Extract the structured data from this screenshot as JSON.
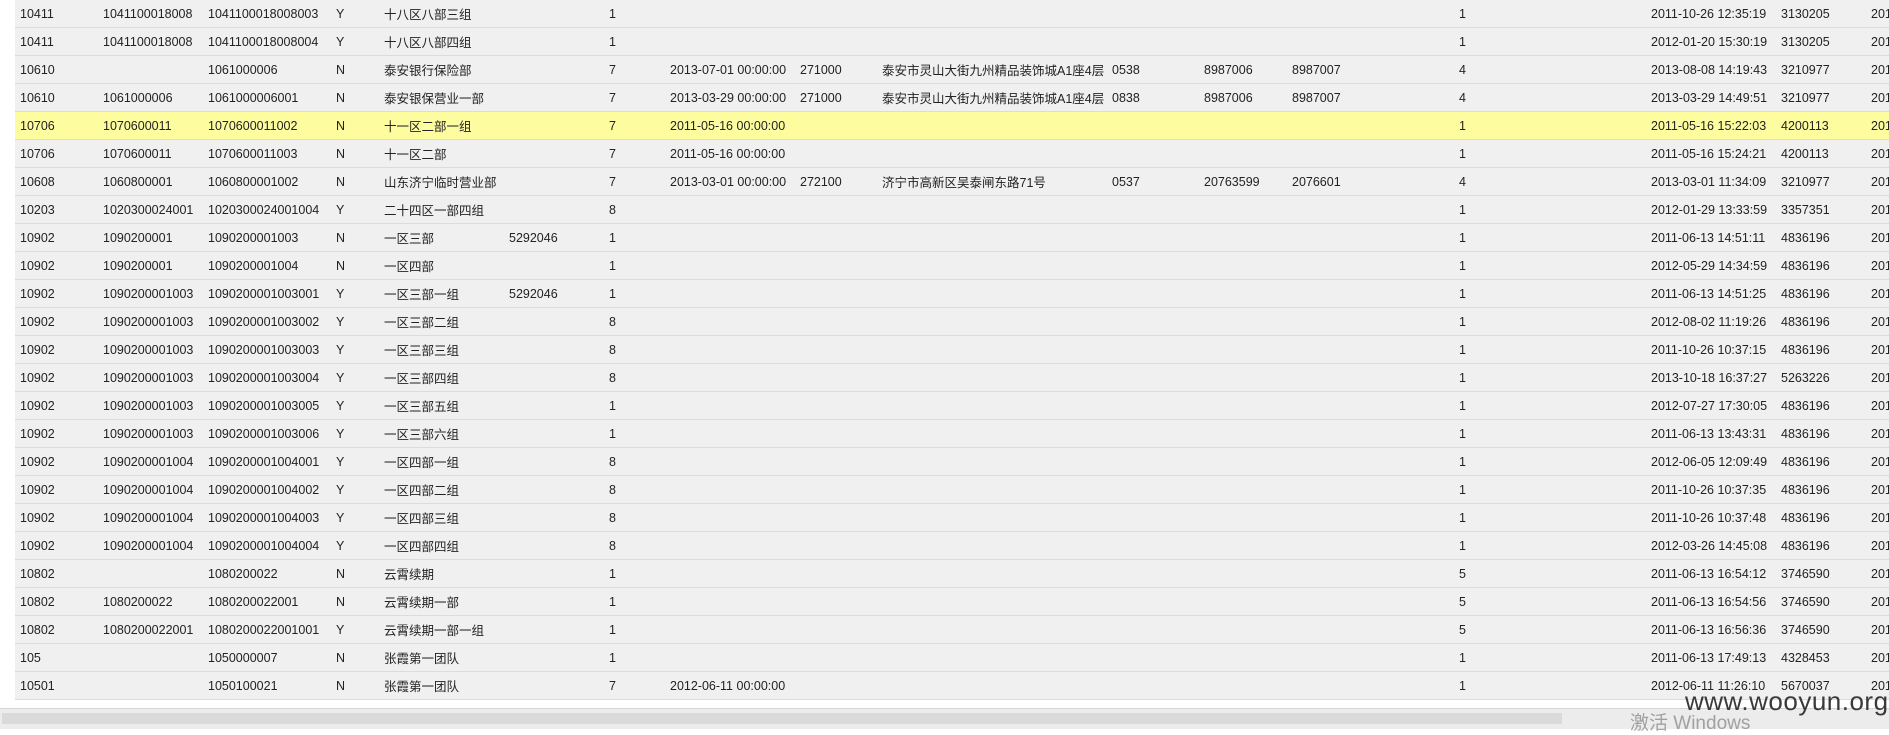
{
  "table": {
    "rows": [
      {
        "c": [
          "10411",
          "1041100018008",
          "1041100018008003",
          "Y",
          "十八区八部三组",
          "",
          "1",
          "",
          "",
          "",
          "",
          "",
          "",
          "1",
          "2011-10-26 12:35:19",
          "3130205",
          "201"
        ],
        "hl": false
      },
      {
        "c": [
          "10411",
          "1041100018008",
          "1041100018008004",
          "Y",
          "十八区八部四组",
          "",
          "1",
          "",
          "",
          "",
          "",
          "",
          "",
          "1",
          "2012-01-20 15:30:19",
          "3130205",
          "201"
        ],
        "hl": false
      },
      {
        "c": [
          "10610",
          "",
          "1061000006",
          "N",
          "泰安银行保险部",
          "",
          "7",
          "2013-07-01 00:00:00",
          "271000",
          "泰安市灵山大街九州精品装饰城A1座4层",
          "0538",
          "8987006",
          "8987007",
          "4",
          "2013-08-08 14:19:43",
          "3210977",
          "201"
        ],
        "hl": false
      },
      {
        "c": [
          "10610",
          "1061000006",
          "1061000006001",
          "N",
          "泰安银保营业一部",
          "",
          "7",
          "2013-03-29 00:00:00",
          "271000",
          "泰安市灵山大街九州精品装饰城A1座4层",
          "0838",
          "8987006",
          "8987007",
          "4",
          "2013-03-29 14:49:51",
          "3210977",
          "201"
        ],
        "hl": false
      },
      {
        "c": [
          "10706",
          "1070600011",
          "1070600011002",
          "N",
          "十一区二部一组",
          "",
          "7",
          "2011-05-16 00:00:00",
          "",
          "",
          "",
          "",
          "",
          "1",
          "2011-05-16 15:22:03",
          "4200113",
          "201"
        ],
        "hl": true
      },
      {
        "c": [
          "10706",
          "1070600011",
          "1070600011003",
          "N",
          "十一区二部",
          "",
          "7",
          "2011-05-16 00:00:00",
          "",
          "",
          "",
          "",
          "",
          "1",
          "2011-05-16 15:24:21",
          "4200113",
          "201"
        ],
        "hl": false
      },
      {
        "c": [
          "10608",
          "1060800001",
          "1060800001002",
          "N",
          "山东济宁临时营业部",
          "",
          "7",
          "2013-03-01 00:00:00",
          "272100",
          "济宁市高新区吴泰闸东路71号",
          "0537",
          "20763599",
          "2076601",
          "4",
          "2013-03-01 11:34:09",
          "3210977",
          "201"
        ],
        "hl": false
      },
      {
        "c": [
          "10203",
          "1020300024001",
          "1020300024001004",
          "Y",
          "二十四区一部四组",
          "",
          "8",
          "",
          "",
          "",
          "",
          "",
          "",
          "1",
          "2012-01-29 13:33:59",
          "3357351",
          "201"
        ],
        "hl": false
      },
      {
        "c": [
          "10902",
          "1090200001",
          "1090200001003",
          "N",
          "一区三部",
          "5292046",
          "1",
          "",
          "",
          "",
          "",
          "",
          "",
          "1",
          "2011-06-13 14:51:11",
          "4836196",
          "201"
        ],
        "hl": false
      },
      {
        "c": [
          "10902",
          "1090200001",
          "1090200001004",
          "N",
          "一区四部",
          "",
          "1",
          "",
          "",
          "",
          "",
          "",
          "",
          "1",
          "2012-05-29 14:34:59",
          "4836196",
          "201"
        ],
        "hl": false
      },
      {
        "c": [
          "10902",
          "1090200001003",
          "1090200001003001",
          "Y",
          "一区三部一组",
          "5292046",
          "1",
          "",
          "",
          "",
          "",
          "",
          "",
          "1",
          "2011-06-13 14:51:25",
          "4836196",
          "201"
        ],
        "hl": false
      },
      {
        "c": [
          "10902",
          "1090200001003",
          "1090200001003002",
          "Y",
          "一区三部二组",
          "",
          "8",
          "",
          "",
          "",
          "",
          "",
          "",
          "1",
          "2012-08-02 11:19:26",
          "4836196",
          "201"
        ],
        "hl": false
      },
      {
        "c": [
          "10902",
          "1090200001003",
          "1090200001003003",
          "Y",
          "一区三部三组",
          "",
          "8",
          "",
          "",
          "",
          "",
          "",
          "",
          "1",
          "2011-10-26 10:37:15",
          "4836196",
          "201"
        ],
        "hl": false
      },
      {
        "c": [
          "10902",
          "1090200001003",
          "1090200001003004",
          "Y",
          "一区三部四组",
          "",
          "8",
          "",
          "",
          "",
          "",
          "",
          "",
          "1",
          "2013-10-18 16:37:27",
          "5263226",
          "201"
        ],
        "hl": false
      },
      {
        "c": [
          "10902",
          "1090200001003",
          "1090200001003005",
          "Y",
          "一区三部五组",
          "",
          "1",
          "",
          "",
          "",
          "",
          "",
          "",
          "1",
          "2012-07-27 17:30:05",
          "4836196",
          "201"
        ],
        "hl": false
      },
      {
        "c": [
          "10902",
          "1090200001003",
          "1090200001003006",
          "Y",
          "一区三部六组",
          "",
          "1",
          "",
          "",
          "",
          "",
          "",
          "",
          "1",
          "2011-06-13 13:43:31",
          "4836196",
          "201"
        ],
        "hl": false
      },
      {
        "c": [
          "10902",
          "1090200001004",
          "1090200001004001",
          "Y",
          "一区四部一组",
          "",
          "8",
          "",
          "",
          "",
          "",
          "",
          "",
          "1",
          "2012-06-05 12:09:49",
          "4836196",
          "201"
        ],
        "hl": false
      },
      {
        "c": [
          "10902",
          "1090200001004",
          "1090200001004002",
          "Y",
          "一区四部二组",
          "",
          "8",
          "",
          "",
          "",
          "",
          "",
          "",
          "1",
          "2011-10-26 10:37:35",
          "4836196",
          "201"
        ],
        "hl": false
      },
      {
        "c": [
          "10902",
          "1090200001004",
          "1090200001004003",
          "Y",
          "一区四部三组",
          "",
          "8",
          "",
          "",
          "",
          "",
          "",
          "",
          "1",
          "2011-10-26 10:37:48",
          "4836196",
          "201"
        ],
        "hl": false
      },
      {
        "c": [
          "10902",
          "1090200001004",
          "1090200001004004",
          "Y",
          "一区四部四组",
          "",
          "8",
          "",
          "",
          "",
          "",
          "",
          "",
          "1",
          "2012-03-26 14:45:08",
          "4836196",
          "201"
        ],
        "hl": false
      },
      {
        "c": [
          "10802",
          "",
          "1080200022",
          "N",
          "云霄续期",
          "",
          "1",
          "",
          "",
          "",
          "",
          "",
          "",
          "5",
          "2011-06-13 16:54:12",
          "3746590",
          "201"
        ],
        "hl": false
      },
      {
        "c": [
          "10802",
          "1080200022",
          "1080200022001",
          "N",
          "云霄续期一部",
          "",
          "1",
          "",
          "",
          "",
          "",
          "",
          "",
          "5",
          "2011-06-13 16:54:56",
          "3746590",
          "201"
        ],
        "hl": false
      },
      {
        "c": [
          "10802",
          "1080200022001",
          "1080200022001001",
          "Y",
          "云霄续期一部一组",
          "",
          "1",
          "",
          "",
          "",
          "",
          "",
          "",
          "5",
          "2011-06-13 16:56:36",
          "3746590",
          "201"
        ],
        "hl": false
      },
      {
        "c": [
          "105",
          "",
          "1050000007",
          "N",
          "张霞第一团队",
          "",
          "1",
          "",
          "",
          "",
          "",
          "",
          "",
          "1",
          "2011-06-13 17:49:13",
          "4328453",
          "201"
        ],
        "hl": false
      },
      {
        "c": [
          "10501",
          "",
          "1050100021",
          "N",
          "张霞第一团队",
          "",
          "7",
          "2012-06-11 00:00:00",
          "",
          "",
          "",
          "",
          "",
          "1",
          "2012-06-11 11:26:10",
          "5670037",
          "201"
        ],
        "hl": false
      }
    ]
  },
  "overlay": {
    "watermark": "www.wooyun.org",
    "activation": "激活 Windows"
  }
}
